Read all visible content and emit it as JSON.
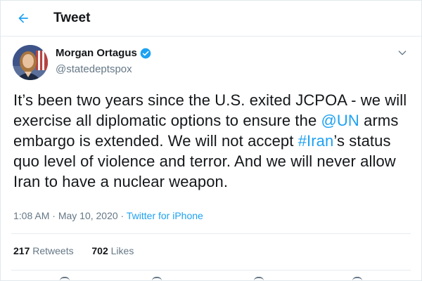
{
  "header": {
    "title": "Tweet",
    "back_icon": "arrow-left-icon"
  },
  "author": {
    "name": "Morgan Ortagus",
    "handle": "@statedeptspox",
    "verified": true
  },
  "tweet": {
    "text_parts": [
      "It’s been two years since the U.S. exited JCPOA - we will exercise all diplomatic options to ensure the ",
      "@UN",
      " arms embargo is extended. We will not accept ",
      "#Iran",
      "’s status quo level of violence and terror. And we will never allow Iran to have a nuclear weapon."
    ]
  },
  "meta": {
    "time": "1:08 AM",
    "sep1": " · ",
    "date": "May 10, 2020",
    "sep2": " · ",
    "source": "Twitter for iPhone"
  },
  "stats": {
    "retweets_count": "217",
    "retweets_label": "Retweets",
    "likes_count": "702",
    "likes_label": "Likes"
  },
  "colors": {
    "accent": "#1da1f2",
    "verified": "#1da1f2",
    "muted": "#657786",
    "text": "#14171a"
  }
}
